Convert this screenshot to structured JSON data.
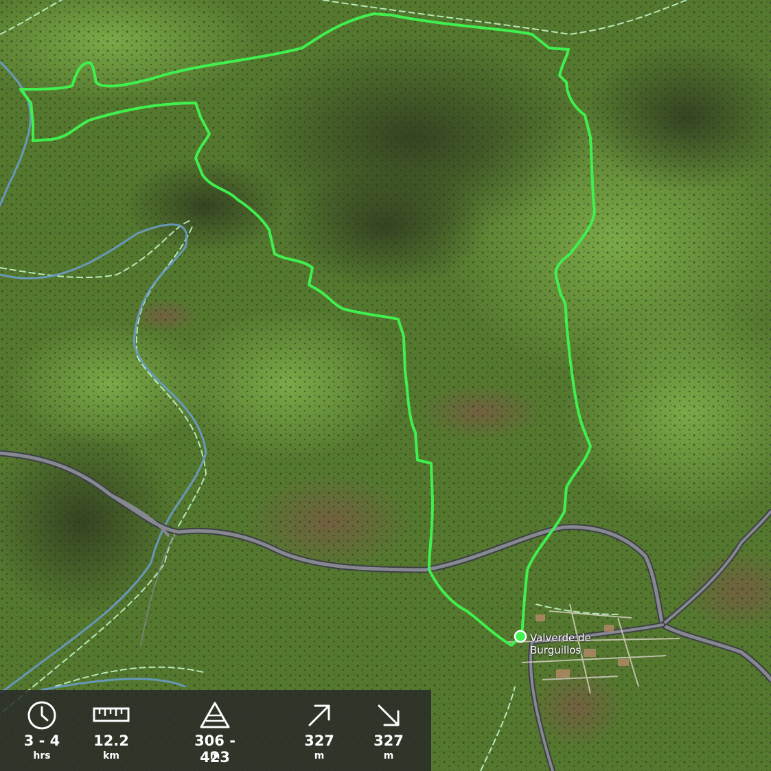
{
  "map": {
    "town_label_line1": "Valverde de",
    "town_label_line2": "Burguillos",
    "colors": {
      "route": "#3ff04e",
      "river": "#6a9cc8",
      "road": "#5b5e66",
      "boundary": "#c8ffd0",
      "start_marker": "#3ff04e"
    }
  },
  "stats": {
    "duration": {
      "icon": "clock-icon",
      "value": "3 - 4",
      "unit": "hrs"
    },
    "distance": {
      "icon": "ruler-icon",
      "value": "12.2",
      "unit": "km"
    },
    "elevation": {
      "icon": "mountain-icon",
      "value": "306 - 423",
      "unit": "m"
    },
    "ascent": {
      "icon": "arrow-up-right-icon",
      "value": "327",
      "unit": "m"
    },
    "descent": {
      "icon": "arrow-down-right-icon",
      "value": "327",
      "unit": "m"
    }
  }
}
